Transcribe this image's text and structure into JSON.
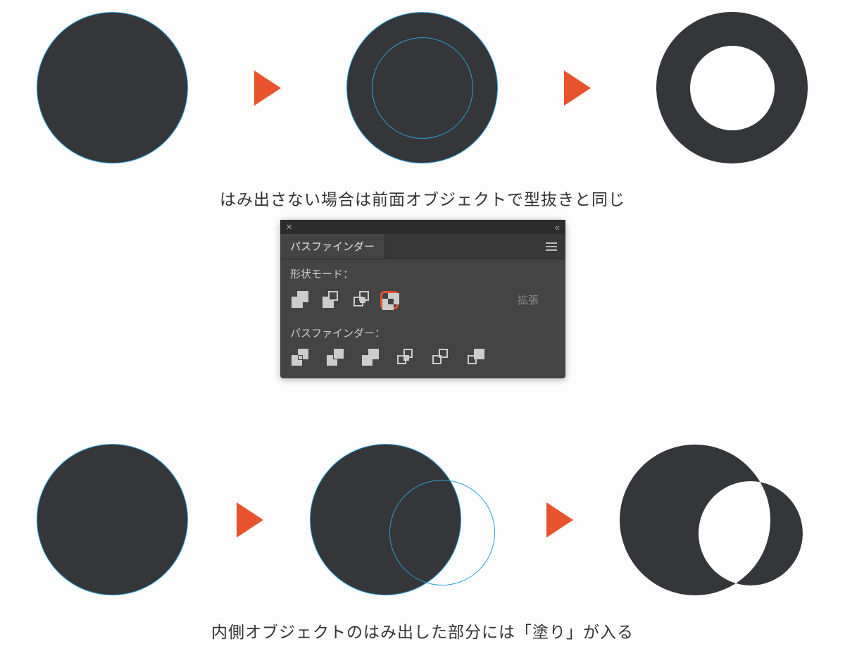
{
  "captions": {
    "top": "はみ出さない場合は前面オブジェクトで型抜きと同じ",
    "bottom": "内側オブジェクトのはみ出した部分には「塗り」が入る"
  },
  "panel": {
    "tab_title": "パスファインダー",
    "shape_mode_label": "形状モード：",
    "expand_label": "拡張",
    "pathfinder_label": "パスファインダー：",
    "shape_mode_icons": [
      "unite",
      "minus-front",
      "intersect",
      "exclude"
    ],
    "pathfinder_icons": [
      "divide",
      "trim",
      "merge",
      "crop",
      "outline",
      "minus-back"
    ],
    "highlighted_shape_mode": "exclude"
  },
  "colors": {
    "shape_fill": "#353639",
    "selection_outline": "#2a9fd6",
    "accent": "#e6532d"
  }
}
